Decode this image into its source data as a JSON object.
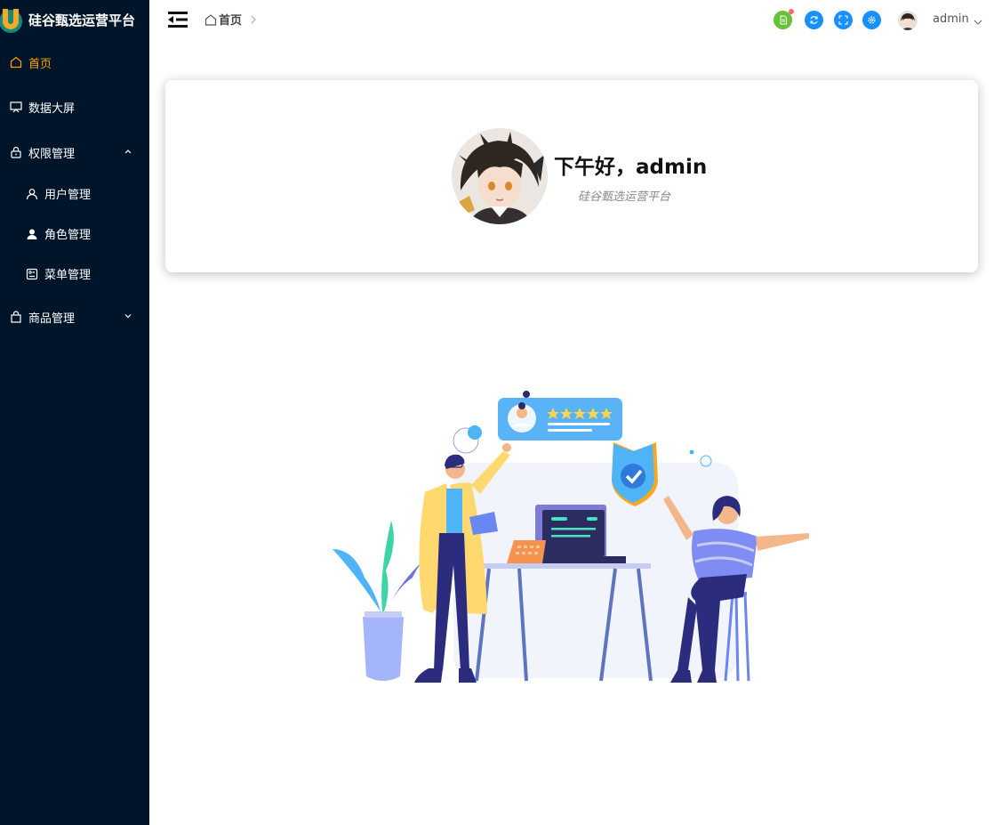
{
  "app": {
    "title": "硅谷甄选运营平台"
  },
  "sidebar": {
    "items": [
      {
        "label": "首页",
        "icon": "home-icon",
        "active": true
      },
      {
        "label": "数据大屏",
        "icon": "monitor-icon"
      },
      {
        "label": "权限管理",
        "icon": "lock-icon",
        "expanded": true,
        "children": [
          {
            "label": "用户管理",
            "icon": "user-icon"
          },
          {
            "label": "角色管理",
            "icon": "user-filled-icon"
          },
          {
            "label": "菜单管理",
            "icon": "menu-grid-icon"
          }
        ]
      },
      {
        "label": "商品管理",
        "icon": "shopping-bag-icon",
        "expanded": false
      }
    ]
  },
  "header": {
    "breadcrumb": [
      "首页"
    ],
    "username": "admin",
    "buttons": [
      {
        "icon": "document-icon",
        "color": "#67c23a"
      },
      {
        "icon": "refresh-icon",
        "color": "#1890ff"
      },
      {
        "icon": "fullscreen-icon",
        "color": "#1890ff"
      },
      {
        "icon": "settings-icon",
        "color": "#1890ff"
      }
    ]
  },
  "welcome": {
    "greeting": "下午好，admin",
    "subtitle": "硅谷甄选运营平台"
  },
  "colors": {
    "sidebar_bg": "#001529",
    "active": "#ffa500"
  }
}
